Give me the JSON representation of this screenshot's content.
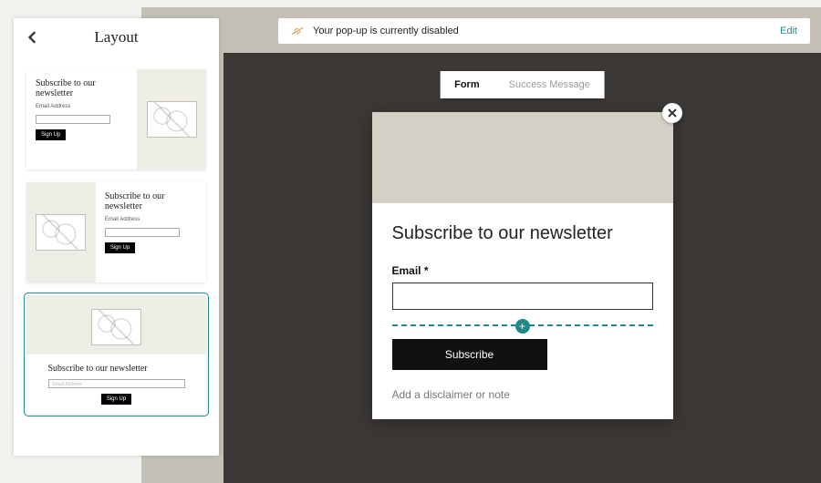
{
  "sidebar": {
    "title": "Layout",
    "cards": [
      {
        "title": "Subscribe to our newsletter",
        "sub": "Email Address",
        "btn": "Sign Up"
      },
      {
        "title": "Subscribe to our newsletter",
        "sub": "Email Address",
        "btn": "Sign Up"
      },
      {
        "title": "Subscribe to our newsletter",
        "placeholder": "Email Address",
        "btn": "Sign Up"
      }
    ]
  },
  "topbar": {
    "message": "Your pop-up is currently disabled",
    "edit": "Edit"
  },
  "tabs": {
    "form": "Form",
    "success": "Success Message"
  },
  "popup": {
    "heading": "Subscribe to our newsletter",
    "field_label": "Email",
    "required_mark": "*",
    "cta": "Subscribe",
    "disclaimer": "Add a disclaimer or note"
  }
}
